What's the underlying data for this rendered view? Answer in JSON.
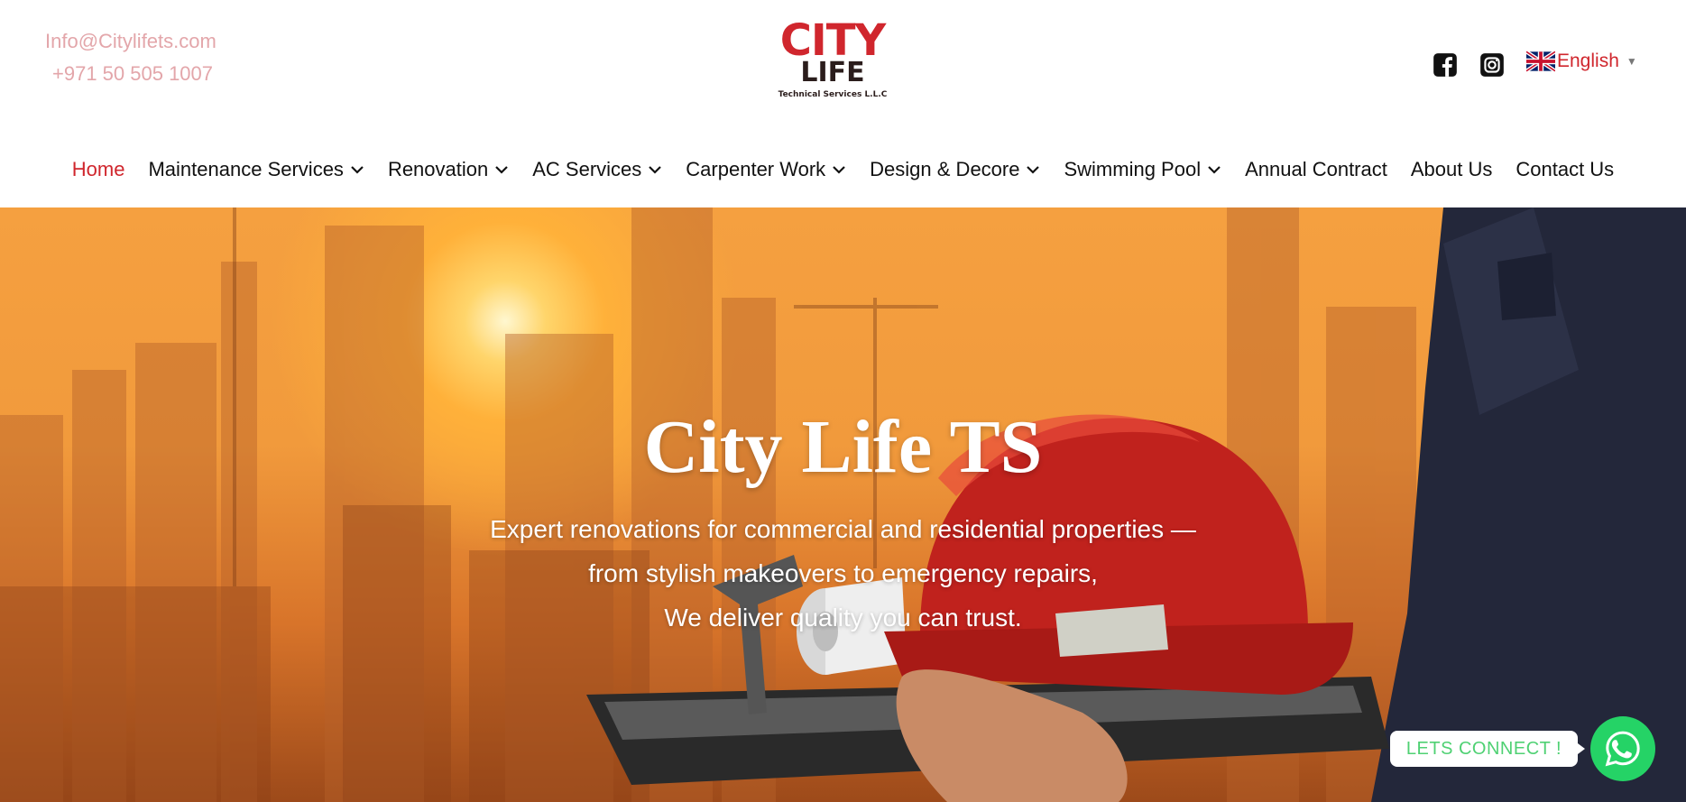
{
  "contact": {
    "email": "Info@Citylifets.com",
    "phone": "+971 50 505 1007"
  },
  "logo": {
    "line1": "CITY",
    "line2": "LIFE",
    "line3": "Technical Services L.L.C"
  },
  "social": {
    "facebook_icon": "facebook-icon",
    "instagram_icon": "instagram-icon"
  },
  "language": {
    "selected": "English",
    "flag_icon": "uk-flag-icon"
  },
  "nav": {
    "items": [
      {
        "label": "Home",
        "active": true,
        "dropdown": false
      },
      {
        "label": "Maintenance Services",
        "active": false,
        "dropdown": true
      },
      {
        "label": "Renovation",
        "active": false,
        "dropdown": true
      },
      {
        "label": "AC Services",
        "active": false,
        "dropdown": true
      },
      {
        "label": "Carpenter Work",
        "active": false,
        "dropdown": true
      },
      {
        "label": "Design & Decore",
        "active": false,
        "dropdown": true
      },
      {
        "label": "Swimming Pool",
        "active": false,
        "dropdown": true
      },
      {
        "label": "Annual Contract",
        "active": false,
        "dropdown": false
      },
      {
        "label": "About Us",
        "active": false,
        "dropdown": false
      },
      {
        "label": "Contact Us",
        "active": false,
        "dropdown": false
      }
    ]
  },
  "hero": {
    "title": "City Life TS",
    "subtitle_line1": "Expert renovations for commercial and residential properties —",
    "subtitle_line2": "from stylish makeovers to emergency repairs,",
    "subtitle_line3": "We deliver quality you can trust."
  },
  "chat": {
    "label": "LETS CONNECT !",
    "icon": "whatsapp-icon"
  },
  "colors": {
    "brand_red": "#d0262d",
    "contact_pink": "#e3a6aa",
    "whatsapp_green": "#25d366"
  }
}
